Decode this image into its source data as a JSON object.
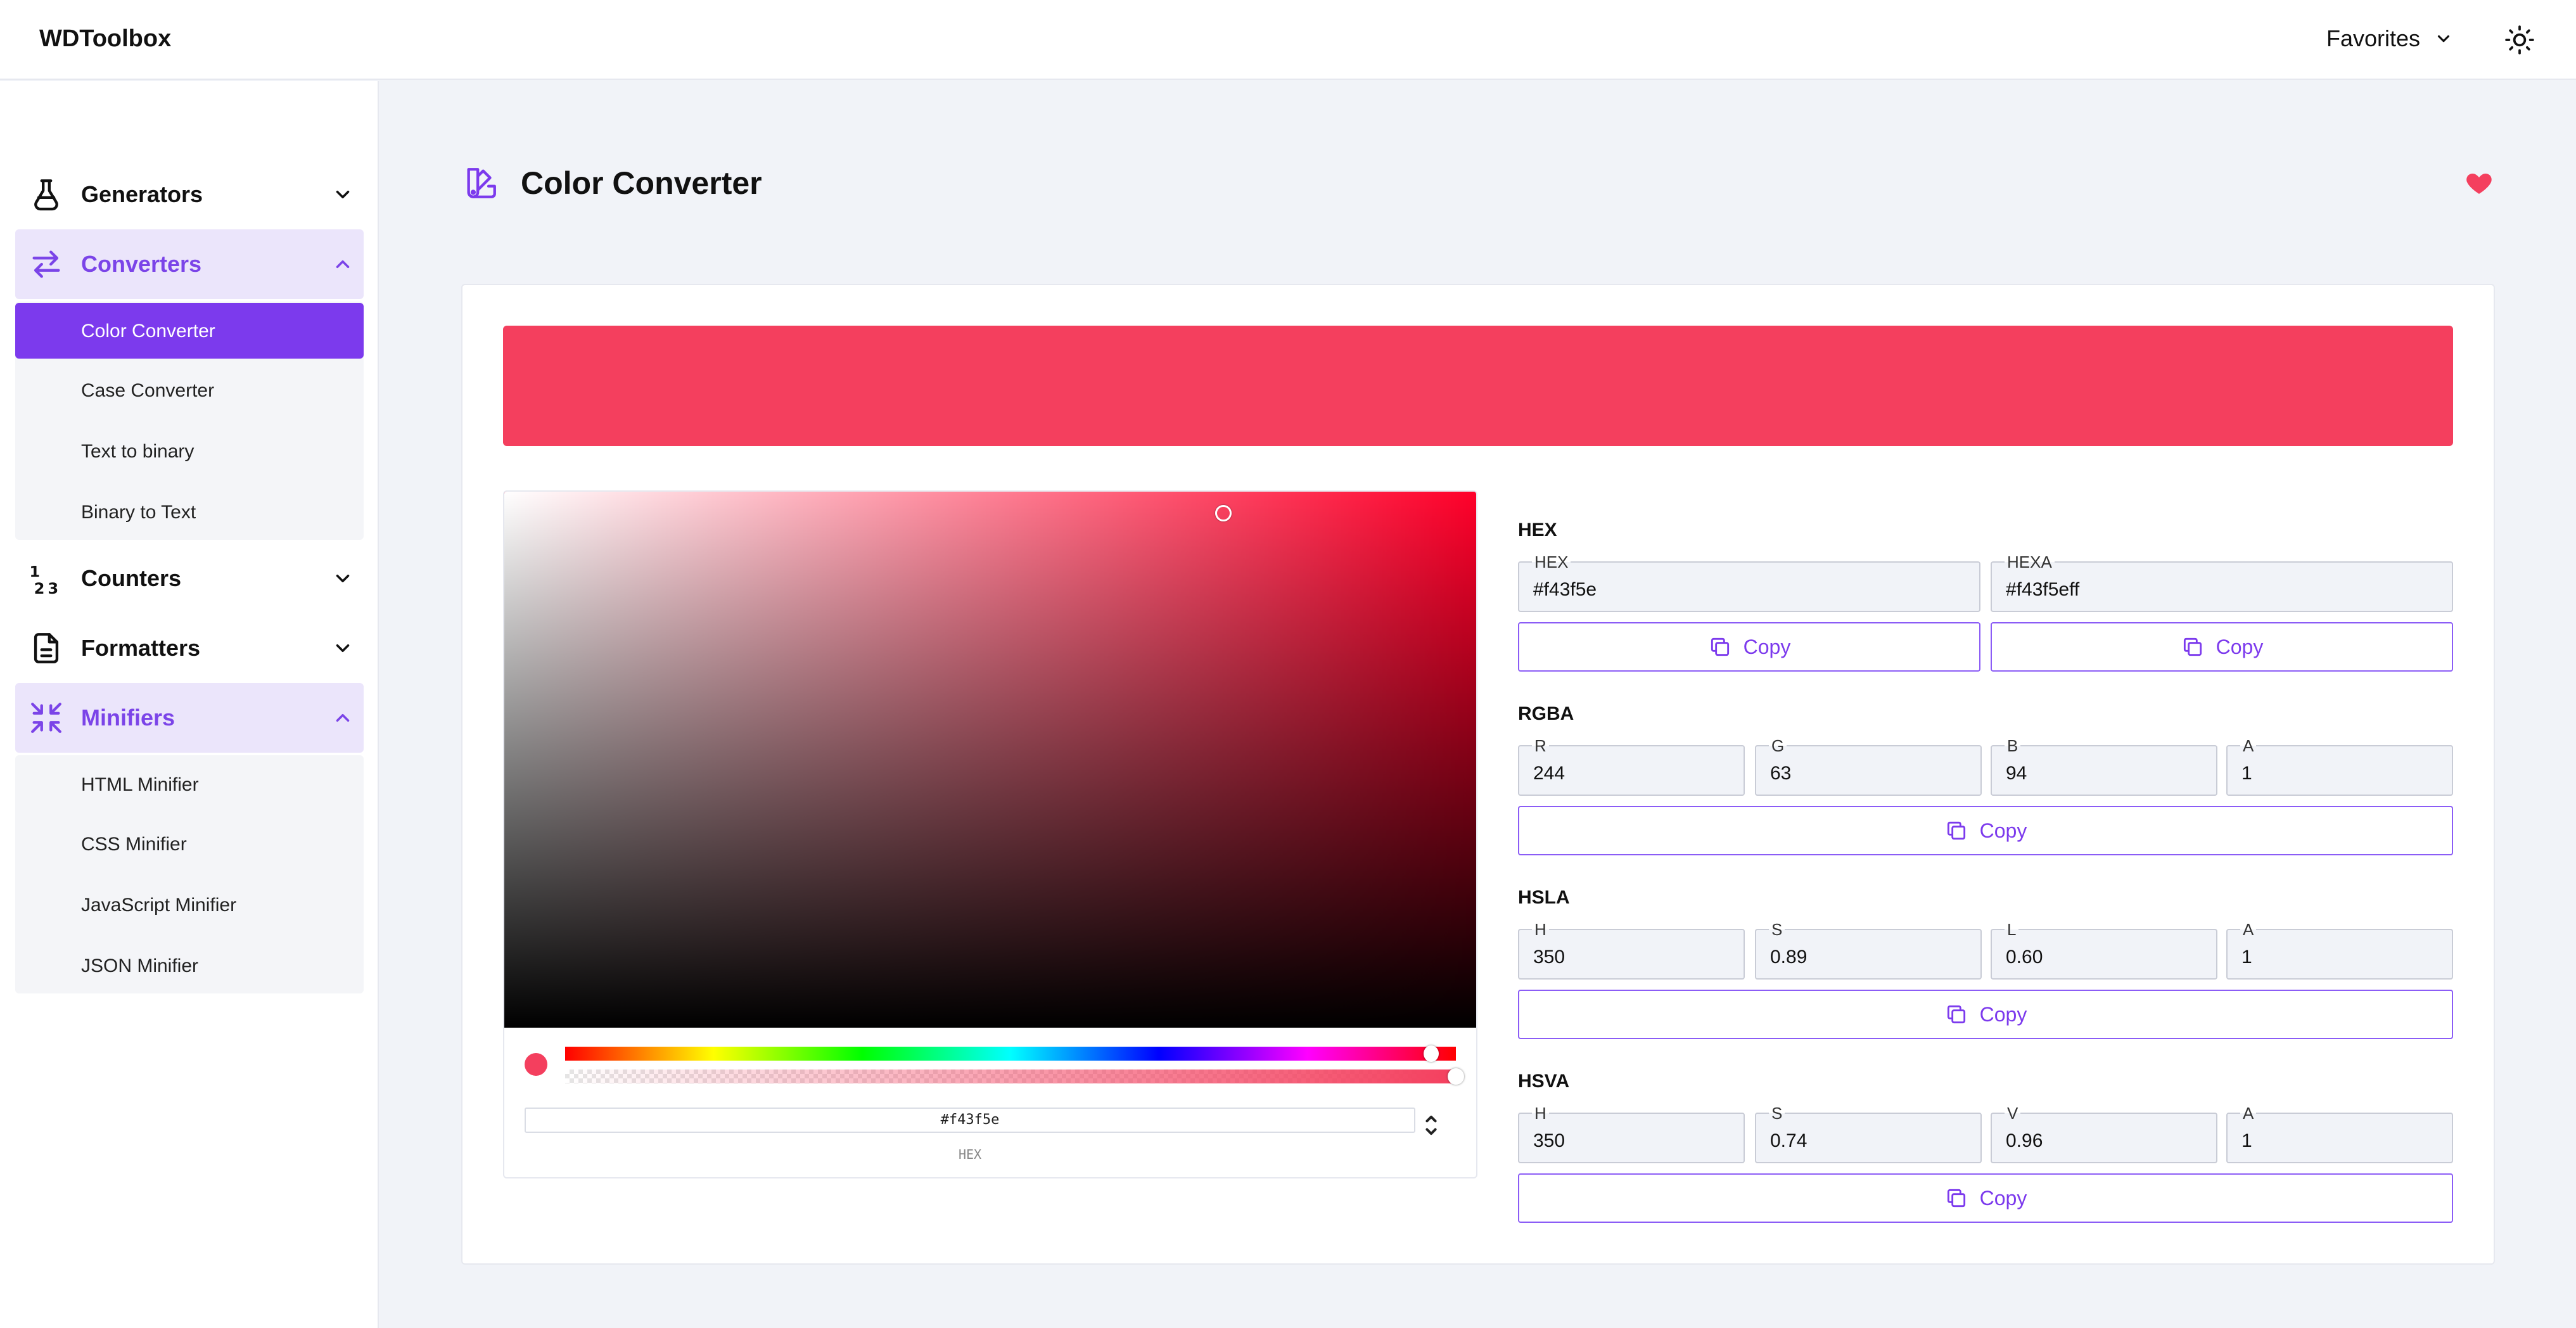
{
  "app": {
    "brand": "WDToolbox",
    "favorites_label": "Favorites"
  },
  "sidebar": {
    "groups": [
      {
        "label": "Generators",
        "expanded": false
      },
      {
        "label": "Converters",
        "expanded": true,
        "items": [
          "Color Converter",
          "Case Converter",
          "Text to binary",
          "Binary to Text"
        ],
        "selected": "Color Converter"
      },
      {
        "label": "Counters",
        "expanded": false
      },
      {
        "label": "Formatters",
        "expanded": false
      },
      {
        "label": "Minifiers",
        "expanded": true,
        "items": [
          "HTML Minifier",
          "CSS Minifier",
          "JavaScript Minifier",
          "JSON Minifier"
        ]
      }
    ]
  },
  "page": {
    "title": "Color Converter",
    "favorited": true
  },
  "color": {
    "current": "#f43f5e",
    "hue_deg": 350,
    "saturation": 0.74,
    "value": 0.96,
    "alpha": 1
  },
  "picker": {
    "hex_value": "#f43f5e",
    "format_label": "HEX"
  },
  "sections": {
    "hex": {
      "title": "HEX",
      "hex_label": "HEX",
      "hex_value": "#f43f5e",
      "hexa_label": "HEXA",
      "hexa_value": "#f43f5eff",
      "copy": "Copy"
    },
    "rgba": {
      "title": "RGBA",
      "r_label": "R",
      "r": "244",
      "g_label": "G",
      "g": "63",
      "b_label": "B",
      "b": "94",
      "a_label": "A",
      "a": "1",
      "copy": "Copy"
    },
    "hsla": {
      "title": "HSLA",
      "h_label": "H",
      "h": "350",
      "s_label": "S",
      "s": "0.89",
      "l_label": "L",
      "l": "0.60",
      "a_label": "A",
      "a": "1",
      "copy": "Copy"
    },
    "hsva": {
      "title": "HSVA",
      "h_label": "H",
      "h": "350",
      "s_label": "S",
      "s": "0.74",
      "v_label": "V",
      "v": "0.96",
      "a_label": "A",
      "a": "1",
      "copy": "Copy"
    }
  },
  "colors": {
    "accent": "#7c3aed",
    "accent_light": "#ebe5fb",
    "heart": "#f43f5e"
  },
  "icons": {
    "generators": "flask-icon",
    "converters": "arrows-swap-icon",
    "counters": "numbers-icon",
    "formatters": "document-icon",
    "minifiers": "minimize-icon",
    "page": "color-palette-icon",
    "heart": "heart-icon",
    "theme": "sun-icon",
    "copy": "copy-icon"
  }
}
